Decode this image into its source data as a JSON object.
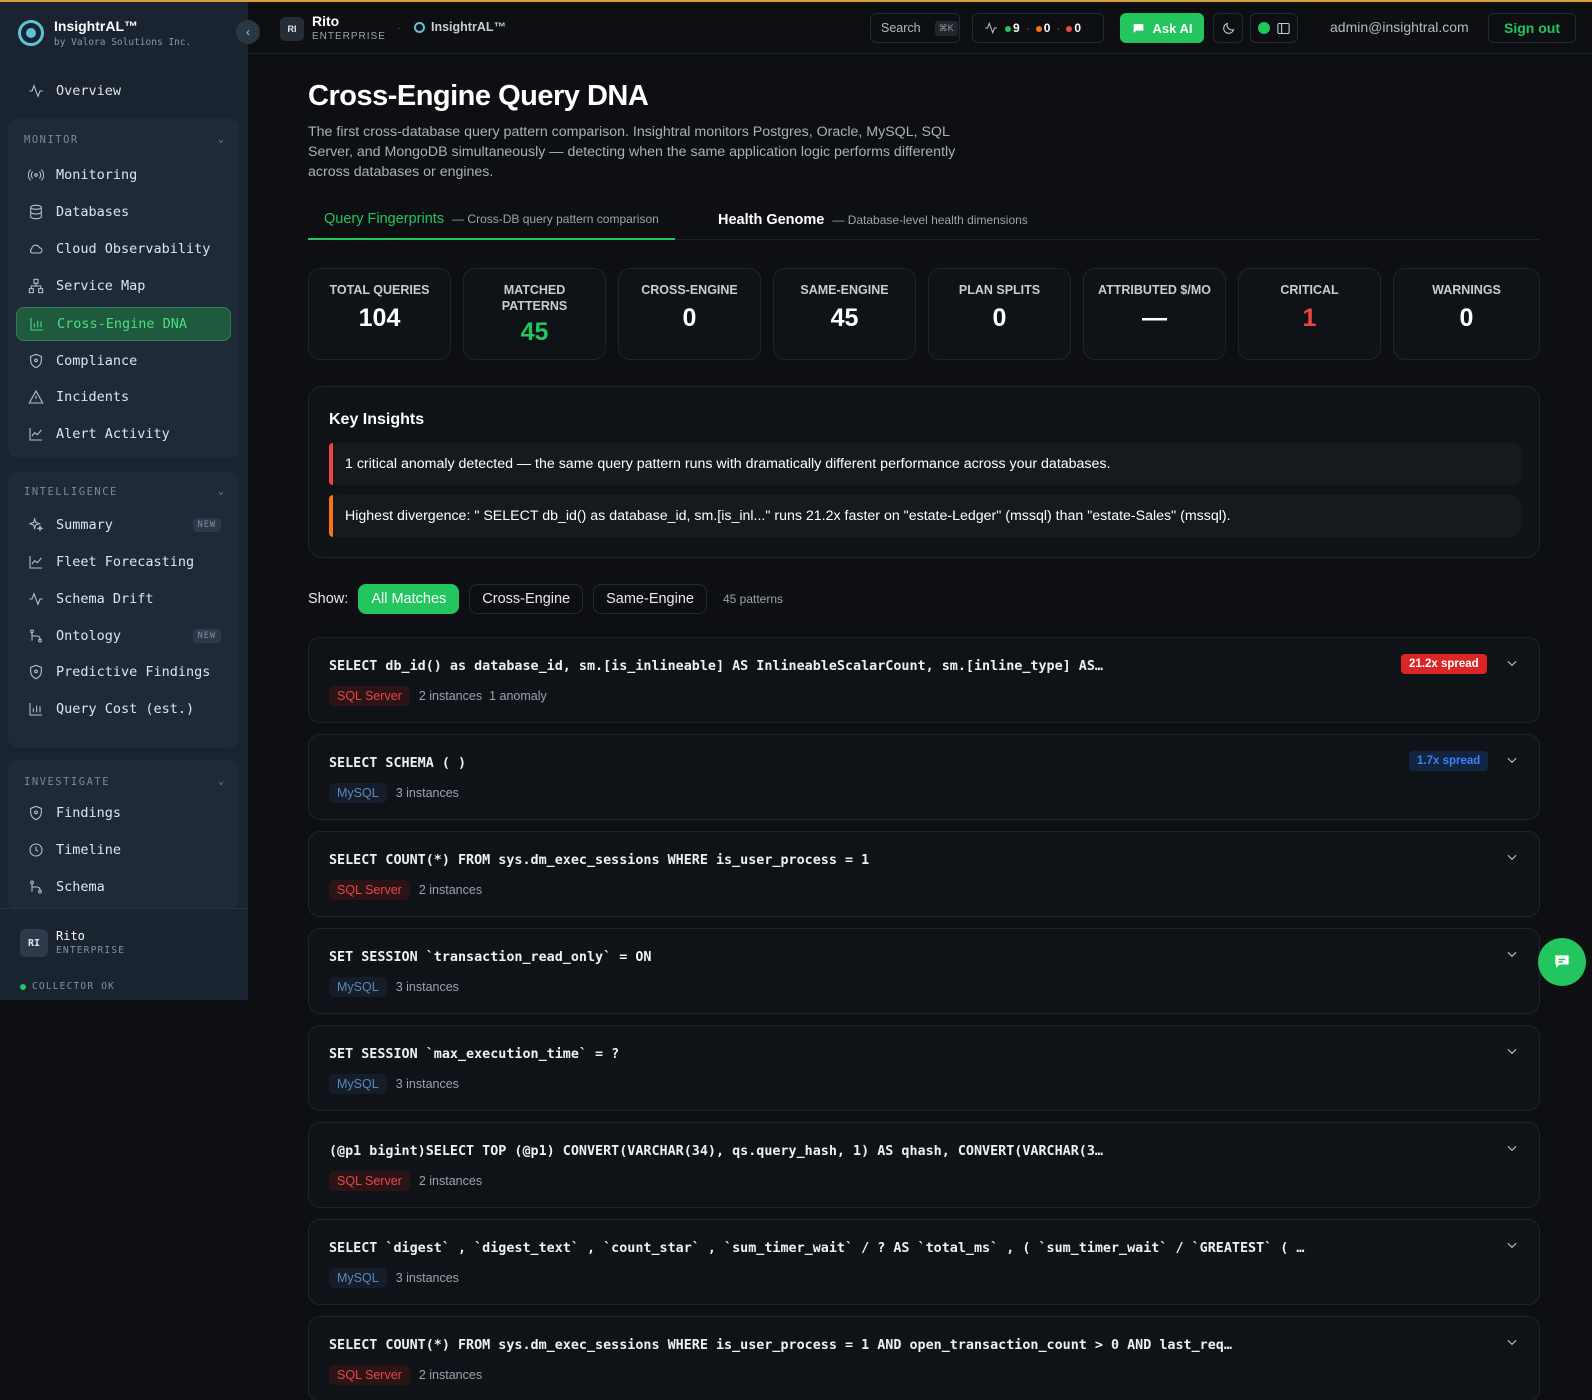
{
  "brand": {
    "title": "InsightrAL™",
    "subtitle": "by Valora Solutions Inc."
  },
  "sidebar": {
    "overview": {
      "label": "Overview",
      "icon": "activity-icon"
    },
    "monitor": {
      "heading": "MONITOR",
      "items": [
        {
          "label": "Monitoring",
          "icon": "broadcast-icon"
        },
        {
          "label": "Databases",
          "icon": "database-icon"
        },
        {
          "label": "Cloud Observability",
          "icon": "cloud-icon"
        },
        {
          "label": "Service Map",
          "icon": "network-icon"
        },
        {
          "label": "Cross-Engine DNA",
          "icon": "bar-chart-icon",
          "active": true
        },
        {
          "label": "Compliance",
          "icon": "shield-icon"
        },
        {
          "label": "Incidents",
          "icon": "warning-icon"
        },
        {
          "label": "Alert Activity",
          "icon": "line-chart-icon"
        }
      ]
    },
    "intelligence": {
      "heading": "INTELLIGENCE",
      "items": [
        {
          "label": "Summary",
          "icon": "sparkles-icon",
          "badge": "NEW"
        },
        {
          "label": "Fleet Forecasting",
          "icon": "line-chart-icon"
        },
        {
          "label": "Schema Drift",
          "icon": "activity-icon"
        },
        {
          "label": "Ontology",
          "icon": "git-branch-icon",
          "badge": "NEW"
        },
        {
          "label": "Predictive Findings",
          "icon": "shield-icon"
        },
        {
          "label": "Query Cost (est.)",
          "icon": "bar-chart-icon"
        }
      ]
    },
    "investigate": {
      "heading": "INVESTIGATE",
      "items": [
        {
          "label": "Findings",
          "icon": "shield-icon"
        },
        {
          "label": "Timeline",
          "icon": "clock-icon"
        },
        {
          "label": "Schema",
          "icon": "git-branch-icon"
        }
      ]
    },
    "user": {
      "initials": "RI",
      "name": "Rito",
      "plan": "ENTERPRISE",
      "collector": "COLLECTOR OK"
    }
  },
  "header": {
    "initials": "RI",
    "name": "Rito",
    "plan": "ENTERPRISE",
    "separator": "·",
    "app": "InsightrAL™",
    "search_label": "Search",
    "search_kbd": "⌘K",
    "status": {
      "green": "9",
      "orange": "0",
      "red": "0",
      "dot_sep": "·"
    },
    "ask_ai": "Ask AI",
    "email": "admin@insightral.com",
    "sign_out": "Sign out"
  },
  "page": {
    "title": "Cross-Engine Query DNA",
    "description": "The first cross-database query pattern comparison. Insightral monitors Postgres, Oracle, MySQL, SQL Server, and MongoDB simultaneously — detecting when the same application logic performs differently across databases or engines.",
    "tabs": [
      {
        "label": "Query Fingerprints",
        "sub": "— Cross-DB query pattern comparison",
        "active": true
      },
      {
        "label": "Health Genome",
        "sub": "— Database-level health dimensions",
        "active": false
      }
    ],
    "stats": [
      {
        "label": "TOTAL QUERIES",
        "value": "104",
        "color": "#ffffff"
      },
      {
        "label": "MATCHED PATTERNS",
        "value": "45",
        "color": "#22c55e"
      },
      {
        "label": "CROSS-ENGINE",
        "value": "0",
        "color": "#ffffff"
      },
      {
        "label": "SAME-ENGINE",
        "value": "45",
        "color": "#ffffff"
      },
      {
        "label": "PLAN SPLITS",
        "value": "0",
        "color": "#ffffff"
      },
      {
        "label": "ATTRIBUTED $/MO",
        "value": "—",
        "color": "#ffffff"
      },
      {
        "label": "CRITICAL",
        "value": "1",
        "color": "#ef4444"
      },
      {
        "label": "WARNINGS",
        "value": "0",
        "color": "#ffffff"
      }
    ],
    "insights": {
      "title": "Key Insights",
      "items": [
        {
          "text": "1 critical anomaly detected — the same query pattern runs with dramatically different performance across your databases.",
          "color": "#ef4444"
        },
        {
          "text": "Highest divergence: \" SELECT db_id() as database_id, sm.[is_inl...\" runs 21.2x faster on \"estate-Ledger\" (mssql) than \"estate-Sales\" (mssql).",
          "color": "#f97316"
        }
      ]
    },
    "filters": {
      "show_label": "Show:",
      "options": [
        "All Matches",
        "Cross-Engine",
        "Same-Engine"
      ],
      "active": "All Matches",
      "count": "45 patterns"
    },
    "queries": [
      {
        "sql": "SELECT db_id() as database_id, sm.[is_inlineable] AS InlineableScalarCount, sm.[inline_type] AS…",
        "engine": "SQL Server",
        "engine_kind": "sql",
        "instances": "2 instances",
        "anomaly": "1 anomaly",
        "spread": "21.2x spread",
        "spread_kind": "red"
      },
      {
        "sql": "SELECT SCHEMA ( )",
        "engine": "MySQL",
        "engine_kind": "mysql",
        "instances": "3 instances",
        "anomaly": "",
        "spread": "1.7x spread",
        "spread_kind": "blue"
      },
      {
        "sql": "SELECT COUNT(*) FROM sys.dm_exec_sessions WHERE is_user_process = 1",
        "engine": "SQL Server",
        "engine_kind": "sql",
        "instances": "2 instances",
        "anomaly": "",
        "spread": "",
        "spread_kind": ""
      },
      {
        "sql": "SET SESSION `transaction_read_only` = ON",
        "engine": "MySQL",
        "engine_kind": "mysql",
        "instances": "3 instances",
        "anomaly": "",
        "spread": "",
        "spread_kind": ""
      },
      {
        "sql": "SET SESSION `max_execution_time` = ?",
        "engine": "MySQL",
        "engine_kind": "mysql",
        "instances": "3 instances",
        "anomaly": "",
        "spread": "",
        "spread_kind": ""
      },
      {
        "sql": "(@p1 bigint)SELECT TOP (@p1) CONVERT(VARCHAR(34), qs.query_hash, 1) AS qhash, CONVERT(VARCHAR(3…",
        "engine": "SQL Server",
        "engine_kind": "sql",
        "instances": "2 instances",
        "anomaly": "",
        "spread": "",
        "spread_kind": ""
      },
      {
        "sql": "SELECT `digest` , `digest_text` , `count_star` , `sum_timer_wait` / ? AS `total_ms` , ( `sum_timer_wait` / `GREATEST` ( …",
        "engine": "MySQL",
        "engine_kind": "mysql",
        "instances": "3 instances",
        "anomaly": "",
        "spread": "",
        "spread_kind": ""
      },
      {
        "sql": "SELECT COUNT(*) FROM sys.dm_exec_sessions WHERE is_user_process = 1 AND open_transaction_count > 0 AND last_req…",
        "engine": "SQL Server",
        "engine_kind": "sql",
        "instances": "2 instances",
        "anomaly": "",
        "spread": "",
        "spread_kind": ""
      }
    ]
  },
  "colors": {
    "accent": "#22c55e",
    "critical": "#ef4444",
    "warning": "#f97316",
    "sidebar_bg": "#1a2330"
  }
}
